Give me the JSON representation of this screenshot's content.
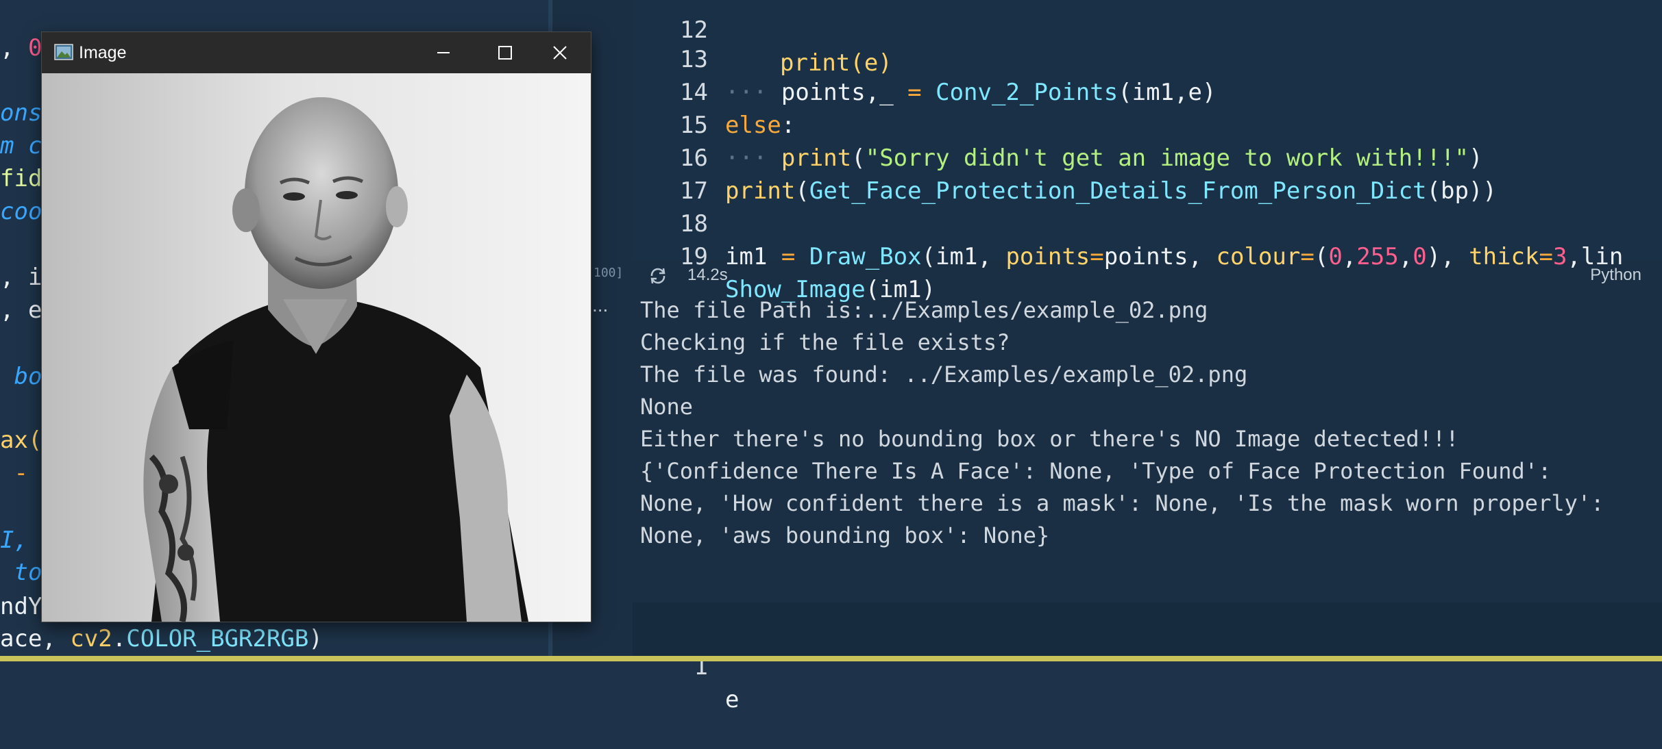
{
  "left_editor": {
    "lines": [
      {
        "text": ", ",
        "accent": "0"
      },
      {
        "text": "ons"
      },
      {
        "text": "m c"
      },
      {
        "text": "fid"
      },
      {
        "text": "coo"
      },
      {
        "text": ", i"
      },
      {
        "text": ", e"
      },
      {
        "text": " bo"
      },
      {
        "text": "ax("
      },
      {
        "text": " -"
      },
      {
        "text": "I, "
      },
      {
        "text": " to"
      },
      {
        "text": "ndY"
      }
    ],
    "bottom_line": {
      "prefix": "ace, ",
      "module": "cv2",
      "dot": ".",
      "constant": "COLOR_BGR2RGB",
      "suffix": ")"
    }
  },
  "image_window": {
    "title": "Image",
    "icon": "image-app-icon",
    "minimize_icon": "minimize-icon",
    "maximize_icon": "maximize-icon",
    "close_icon": "close-icon"
  },
  "code_cell": {
    "lines": [
      {
        "num": "12",
        "text": "print(e)"
      },
      {
        "num": "13",
        "parts": [
          "points",
          ",_",
          " = ",
          "Conv_2_Points",
          "(im1,e)"
        ]
      },
      {
        "num": "14",
        "parts": [
          "else",
          ":"
        ]
      },
      {
        "num": "15",
        "parts": [
          "print",
          "(",
          "\"Sorry didn't get an image to work with!!!\"",
          ")"
        ]
      },
      {
        "num": "16",
        "parts": [
          "print",
          "(",
          "Get_Face_Protection_Details_From_Person_Dict",
          "(bp))"
        ]
      },
      {
        "num": "17",
        "parts": [
          ""
        ]
      },
      {
        "num": "18",
        "parts": [
          "im1",
          " = ",
          "Draw_Box",
          "(im1, ",
          "points",
          "=",
          "points, ",
          "colour",
          "=",
          "(",
          "0",
          ",",
          "255",
          ",",
          "0",
          "), ",
          "thick",
          "=",
          "3",
          ",lin"
        ]
      },
      {
        "num": "19",
        "parts": [
          "Show_Image",
          "(im1)"
        ]
      }
    ]
  },
  "status": {
    "exec_count": "100]",
    "refresh_icon": "refresh-icon",
    "time": "14.2s",
    "language": "Python"
  },
  "output": {
    "more_label": "...",
    "lines": [
      "The file Path is:../Examples/example_02.png",
      "Checking if the file exists?",
      "The file was found: ../Examples/example_02.png",
      "None",
      "Either there's no bounding box or there's NO Image detected!!!",
      "{'Confidence There Is A Face': None, 'Type of Face Protection Found':",
      "None, 'How confident there is a mask': None, 'Is the mask worn properly':",
      "None, 'aws bounding box': None}"
    ]
  },
  "cell2": {
    "num": "1",
    "text": "e"
  }
}
